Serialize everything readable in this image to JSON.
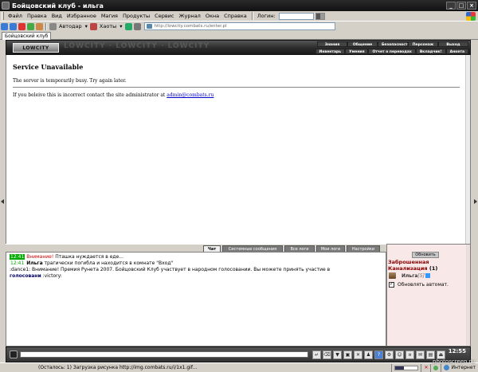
{
  "window": {
    "title": "Бойцовский клуб - ильга"
  },
  "menu": {
    "items": [
      "Файл",
      "Правка",
      "Вид",
      "Избранное",
      "Магия",
      "Продукты",
      "Сервис",
      "Журнал",
      "Окна",
      "Справка"
    ],
    "login_label": "Логин:"
  },
  "toolbar": {
    "autodar_label": "Автодар",
    "hauts_label": "Хаоты",
    "address": "http://lowcity.combats.ru/enter.pl"
  },
  "tab": {
    "label": "Бойцовский клуб"
  },
  "game_header": {
    "logo": "LOWCITY",
    "deco": "LOWCITY · LOWCITY · LOWCITY",
    "nav_top": [
      "Знания",
      "Общение",
      "Безопасность",
      "Персонаж",
      "Выход"
    ],
    "nav_bottom": [
      "Инвентарь",
      "Умения",
      "Отчет о переводах",
      "Вкладчик!",
      "Анкета"
    ]
  },
  "error_page": {
    "title": "Service Unavailable",
    "message": "The server is temporarily busy. Try again later.",
    "contact_prefix": "If you beleive this is incorrect contact the site administrator at",
    "contact_email": "admin@combats.ru"
  },
  "chat_tabs": [
    "Чат",
    "Системные сообщения",
    "Все логи",
    "Мои логи",
    "Настройки"
  ],
  "chat": {
    "line1": {
      "time": "12:41",
      "warn": "Внимание!",
      "text": "Пташка нуждается в еде..."
    },
    "line2": {
      "time": "12:41",
      "nick": "Ильга",
      "text": "трагически погибла и находится в комнате \"Вход\""
    },
    "line3": {
      "text": ":dance1:   Внимание! Премия Рунета 2007. Бойцовский Клуб участвует в народном голосовании. Вы можете принять участие в"
    },
    "line4": {
      "link": "голосовани",
      "text": " :victory:"
    }
  },
  "side_panel": {
    "refresh_label": "Обновить",
    "location": "Заброшенная Канализация",
    "count": "(1)",
    "player_name": "Ильга",
    "player_level": "[5]",
    "auto_refresh_label": "Обновлять автомат."
  },
  "bottom_bar": {
    "clock": "12:55"
  },
  "status_bar": {
    "text": "(Осталось: 1) Загрузка рисунка http://img.combats.ru/i/1x1.gif...",
    "zone": "Интернет"
  },
  "watermark": "photoscreen.ru"
}
